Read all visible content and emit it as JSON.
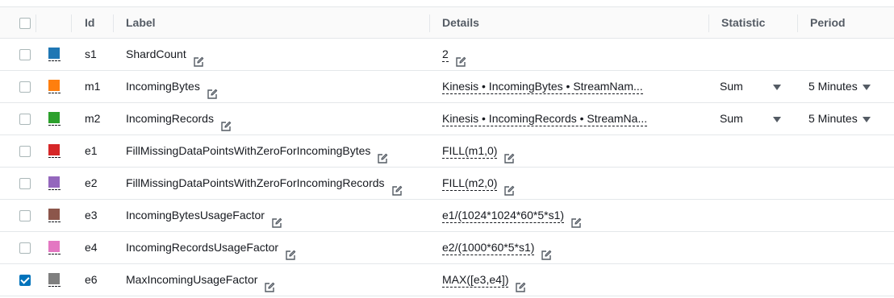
{
  "columns": {
    "id": "Id",
    "label": "Label",
    "details": "Details",
    "statistic": "Statistic",
    "period": "Period"
  },
  "metrics": [
    {
      "id": "s1",
      "label": "ShardCount",
      "details": "2",
      "statistic": "",
      "period": "",
      "color": "#1f77b4",
      "checked": false
    },
    {
      "id": "m1",
      "label": "IncomingBytes",
      "details": "Kinesis • IncomingBytes • StreamNam...",
      "statistic": "Sum",
      "period": "5 Minutes",
      "color": "#ff7f0e",
      "checked": false
    },
    {
      "id": "m2",
      "label": "IncomingRecords",
      "details": "Kinesis • IncomingRecords • StreamNa...",
      "statistic": "Sum",
      "period": "5 Minutes",
      "color": "#2ca02c",
      "checked": false
    },
    {
      "id": "e1",
      "label": "FillMissingDataPointsWithZeroForIncomingBytes",
      "details": "FILL(m1,0)",
      "statistic": "",
      "period": "",
      "color": "#d62728",
      "checked": false
    },
    {
      "id": "e2",
      "label": "FillMissingDataPointsWithZeroForIncomingRecords",
      "details": "FILL(m2,0)",
      "statistic": "",
      "period": "",
      "color": "#9467bd",
      "checked": false
    },
    {
      "id": "e3",
      "label": "IncomingBytesUsageFactor",
      "details": "e1/(1024*1024*60*5*s1)",
      "statistic": "",
      "period": "",
      "color": "#8c564b",
      "checked": false
    },
    {
      "id": "e4",
      "label": "IncomingRecordsUsageFactor",
      "details": "e2/(1000*60*5*s1)",
      "statistic": "",
      "period": "",
      "color": "#e377c2",
      "checked": false
    },
    {
      "id": "e6",
      "label": "MaxIncomingUsageFactor",
      "details": "MAX([e3,e4])",
      "statistic": "",
      "period": "",
      "color": "#7f7f7f",
      "checked": true
    }
  ]
}
